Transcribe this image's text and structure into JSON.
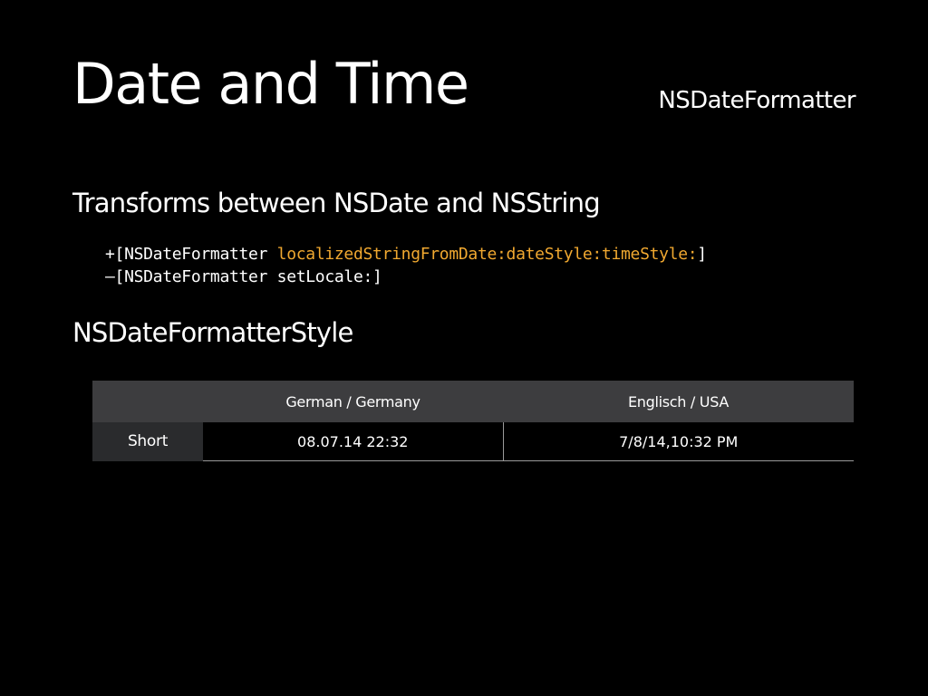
{
  "slide": {
    "title": "Date and Time",
    "subtitle": "NSDateFormatter",
    "bullets": [
      "Transforms between NSDate and NSString",
      "NSDateFormatterStyle"
    ],
    "code": {
      "line1": {
        "prefix": "+[NSDateFormatter ",
        "method": "localizedStringFromDate:dateStyle:timeStyle:",
        "suffix": "]"
      },
      "line2": {
        "text": "–[NSDateFormatter setLocale:]"
      }
    },
    "table": {
      "columns": [
        "",
        "German / Germany",
        "Englisch / USA"
      ],
      "rows": [
        {
          "label": "Short",
          "german": "08.07.14 22:32",
          "english": "7/8/14,10:32 PM"
        }
      ]
    },
    "colors": {
      "background": "#000000",
      "text": "#ffffff",
      "code_highlight": "#f0a830",
      "table_header": "#3d3d3f",
      "table_rowhead": "#2a2b2d"
    }
  }
}
